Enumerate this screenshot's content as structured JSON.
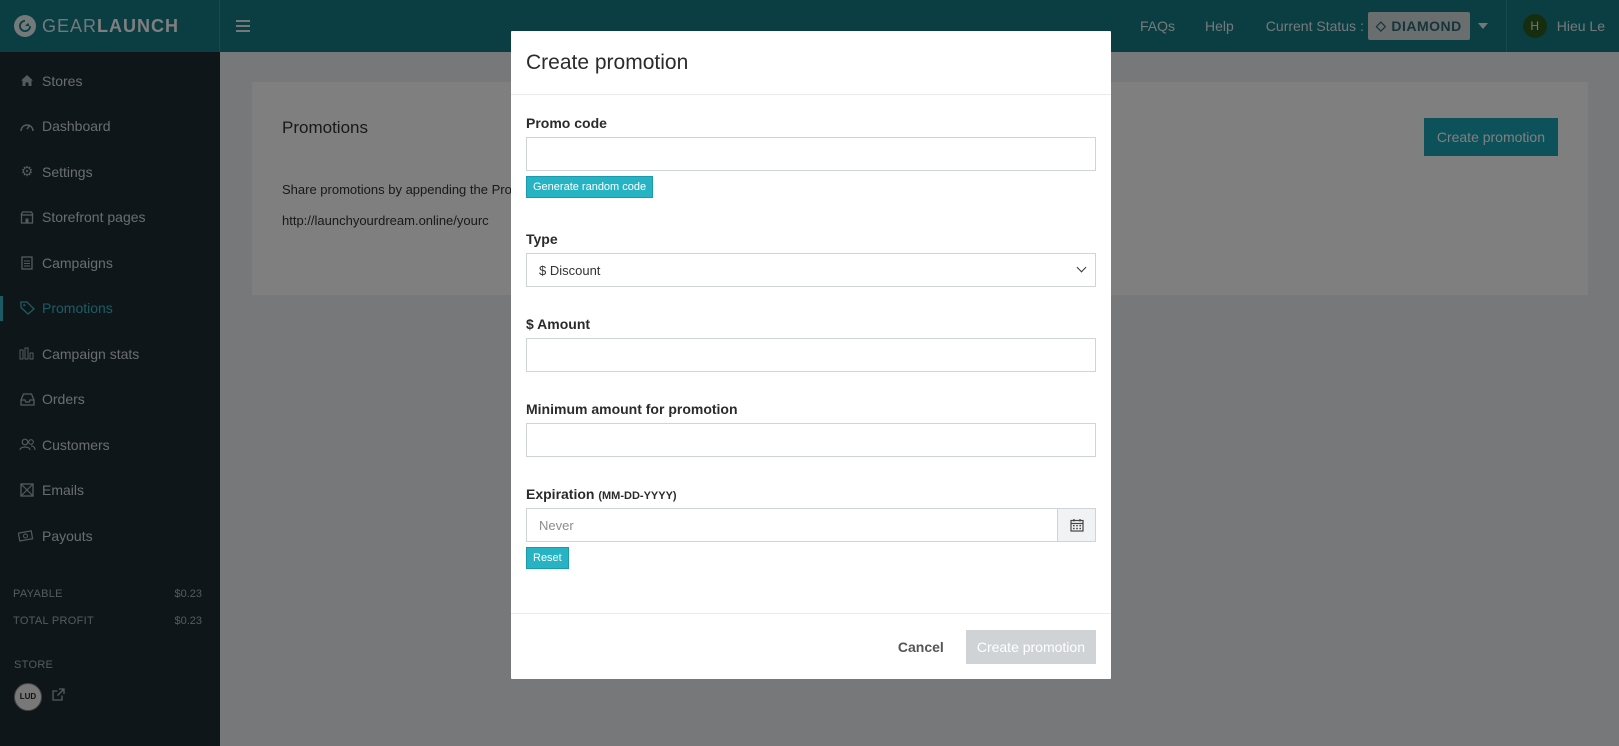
{
  "brand": {
    "light": "GEAR",
    "bold": "LAUNCH"
  },
  "topbar": {
    "faqs": "FAQs",
    "help": "Help",
    "status_label": "Current Status :",
    "status_value": "DIAMOND",
    "avatar_initial": "H",
    "user_name": "Hieu Le"
  },
  "sidebar": {
    "items": [
      {
        "label": "Stores",
        "icon": "home-icon"
      },
      {
        "label": "Dashboard",
        "icon": "gauge-icon"
      },
      {
        "label": "Settings",
        "icon": "gear-icon"
      },
      {
        "label": "Storefront pages",
        "icon": "storefront-icon"
      },
      {
        "label": "Campaigns",
        "icon": "document-icon"
      },
      {
        "label": "Promotions",
        "icon": "tag-icon",
        "active": true
      },
      {
        "label": "Campaign stats",
        "icon": "bar-chart-icon"
      },
      {
        "label": "Orders",
        "icon": "inbox-icon"
      },
      {
        "label": "Customers",
        "icon": "users-icon"
      },
      {
        "label": "Emails",
        "icon": "envelope-icon"
      },
      {
        "label": "Payouts",
        "icon": "money-icon"
      }
    ],
    "payable_label": "PAYABLE",
    "payable_value": "$0.23",
    "total_profit_label": "TOTAL PROFIT",
    "total_profit_value": "$0.23",
    "store_title": "STORE",
    "store_logo_text": "LUD"
  },
  "main": {
    "title": "Promotions",
    "create_button": "Create promotion",
    "share_text": "Share promotions by appending the Pro",
    "url_text": "http://launchyourdream.online/yourc"
  },
  "modal": {
    "title": "Create promotion",
    "promo_code_label": "Promo code",
    "promo_code_value": "",
    "generate_button": "Generate random code",
    "type_label": "Type",
    "type_selected": "$ Discount",
    "amount_label": "$ Amount",
    "amount_value": "",
    "minimum_label": "Minimum amount for promotion",
    "minimum_value": "",
    "expiration_label": "Expiration",
    "expiration_format": "(MM-DD-YYYY)",
    "expiration_placeholder": "Never",
    "reset_button": "Reset",
    "cancel_button": "Cancel",
    "submit_button": "Create promotion"
  },
  "colors": {
    "topbar": "#157d87",
    "sidebar": "#1e2d35",
    "accent": "#39b7c7",
    "primary_button": "#1aa3b4",
    "disabled_button": "#cfd3d5"
  }
}
